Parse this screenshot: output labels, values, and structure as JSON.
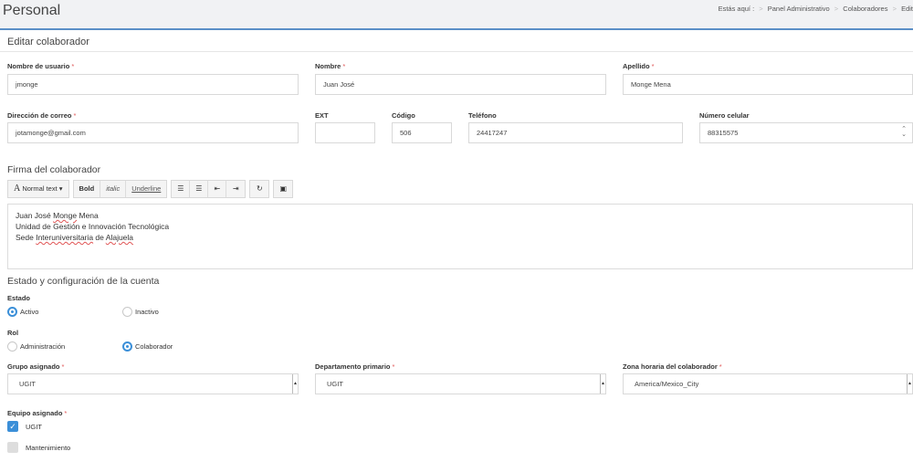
{
  "header": {
    "title": "Personal",
    "breadcrumb_lead": "Estás aquí :",
    "breadcrumb": [
      "Panel Administrativo",
      "Colaboradores",
      "Edit"
    ]
  },
  "panel": {
    "title": "Editar colaborador"
  },
  "fields": {
    "username": {
      "label": "Nombre de usuario",
      "value": "jmonge"
    },
    "name": {
      "label": "Nombre",
      "value": "Juan José"
    },
    "surname": {
      "label": "Apellido",
      "value": "Monge Mena"
    },
    "email": {
      "label": "Dirección de correo",
      "value": "jotamonge@gmail.com"
    },
    "ext": {
      "label": "EXT",
      "value": ""
    },
    "code": {
      "label": "Código",
      "value": "506"
    },
    "phone": {
      "label": "Teléfono",
      "value": "24417247"
    },
    "mobile": {
      "label": "Número celular",
      "value": "88315575"
    }
  },
  "signature": {
    "title": "Firma del colaborador",
    "toolbar": {
      "font_label": "Normal text",
      "bold": "Bold",
      "italic": "italic",
      "underline": "Underline"
    },
    "line1_a": "Juan José ",
    "line1_b": "Monge",
    "line1_c": " Mena",
    "line2": "Unidad de Gestión e Innovación Tecnológica",
    "line3_a": "Sede ",
    "line3_b": "Interuniversitaria",
    "line3_c": " de ",
    "line3_d": "Alajuela"
  },
  "account": {
    "title": "Estado y configuración de la cuenta",
    "status_label": "Estado",
    "status_options": [
      "Activo",
      "Inactivo"
    ],
    "status_selected": "Activo",
    "role_label": "Rol",
    "role_options": [
      "Administración",
      "Colaborador"
    ],
    "role_selected": "Colaborador"
  },
  "selects": {
    "group": {
      "label": "Grupo asignado",
      "value": "UGIT"
    },
    "department": {
      "label": "Departamento primario",
      "value": "UGIT"
    },
    "timezone": {
      "label": "Zona horaria del colaborador",
      "value": "America/Mexico_City"
    }
  },
  "team": {
    "label": "Equipo asignado",
    "items": [
      {
        "label": "UGIT",
        "checked": true
      },
      {
        "label": "Mantenimiento",
        "checked": false
      }
    ]
  },
  "colors": {
    "accent": "#3b8fd8",
    "topbar": "#f1f2f4",
    "topbar_border": "#5b8fc7",
    "required": "#e05555"
  }
}
